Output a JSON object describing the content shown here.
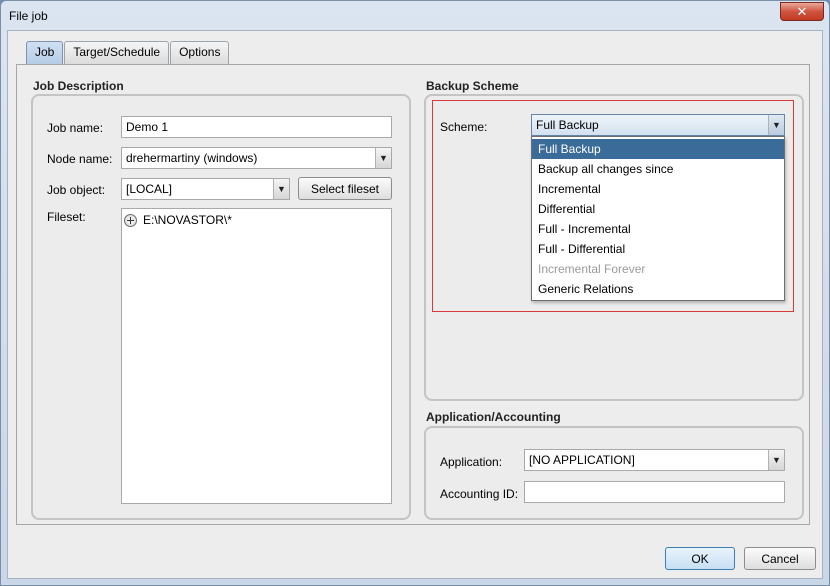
{
  "window": {
    "title": "File job",
    "close_label": "✕"
  },
  "tabs": [
    {
      "label": "Job",
      "active": true
    },
    {
      "label": "Target/Schedule",
      "active": false
    },
    {
      "label": "Options",
      "active": false
    }
  ],
  "job_description": {
    "title": "Job Description",
    "job_name_label": "Job name:",
    "job_name_value": "Demo 1",
    "node_name_label": "Node name:",
    "node_name_value": "drehermartiny (windows)",
    "job_object_label": "Job object:",
    "job_object_value": "[LOCAL]",
    "select_fileset_label": "Select fileset",
    "fileset_label": "Fileset:",
    "fileset_items": [
      {
        "icon": "plus-circle-icon",
        "text": "E:\\NOVASTOR\\*"
      }
    ]
  },
  "backup_scheme": {
    "title": "Backup Scheme",
    "scheme_label": "Scheme:",
    "scheme_value": "Full Backup",
    "highlight_color": "#d83a3a",
    "options": [
      {
        "label": "Full Backup",
        "state": "selected"
      },
      {
        "label": "Backup all changes since",
        "state": "normal"
      },
      {
        "label": "Incremental",
        "state": "normal"
      },
      {
        "label": "Differential",
        "state": "normal"
      },
      {
        "label": "Full - Incremental",
        "state": "normal"
      },
      {
        "label": "Full - Differential",
        "state": "normal"
      },
      {
        "label": "Incremental Forever",
        "state": "disabled"
      },
      {
        "label": "Generic Relations",
        "state": "normal"
      }
    ]
  },
  "application_accounting": {
    "title": "Application/Accounting",
    "application_label": "Application:",
    "application_value": "[NO APPLICATION]",
    "accounting_id_label": "Accounting ID:",
    "accounting_id_value": ""
  },
  "footer": {
    "ok_label": "OK",
    "cancel_label": "Cancel"
  },
  "icons": {
    "dropdown_arrow": "▼"
  }
}
